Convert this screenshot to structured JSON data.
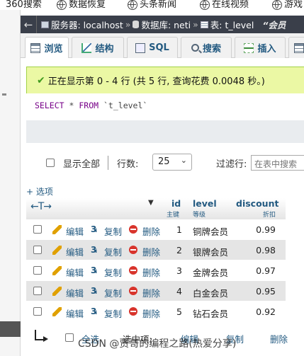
{
  "bookmarks": [
    "360搜索",
    "数据恢复",
    "头条新闻",
    "在线视频",
    "游戏"
  ],
  "breadcrumb": {
    "server": "服务器: localhost",
    "database": "数据库: neti",
    "table": "表: t_level",
    "right": "“会员"
  },
  "tabs": [
    {
      "label": "浏览",
      "icon": "browse-icon",
      "active": true
    },
    {
      "label": "结构",
      "icon": "structure-icon"
    },
    {
      "label": "SQL",
      "icon": "sql-icon"
    },
    {
      "label": "搜索",
      "icon": "search-icon"
    },
    {
      "label": "插入",
      "icon": "insert-icon"
    }
  ],
  "message": "正在显示第 0 - 4 行 (共 5 行, 查询花费 0.0048 秒。)",
  "sql": {
    "select": "SELECT",
    "star": "*",
    "from": "FROM",
    "table": "`t_level`"
  },
  "controls": {
    "show_all": "显示全部",
    "rows_label": "行数:",
    "rows_value": "25",
    "filter_label": "过滤行:",
    "filter_placeholder": "在表中搜索"
  },
  "options_link": "+ 选项",
  "table": {
    "columns": [
      {
        "name": "id",
        "sub": "主键"
      },
      {
        "name": "level",
        "sub": "等级"
      },
      {
        "name": "discount",
        "sub": "折扣"
      }
    ],
    "action_labels": {
      "edit": "编辑",
      "copy": "复制",
      "delete": "删除"
    },
    "rows": [
      {
        "id": "1",
        "level": "铜牌会员",
        "discount": "0.99"
      },
      {
        "id": "2",
        "level": "银牌会员",
        "discount": "0.98"
      },
      {
        "id": "3",
        "level": "金牌会员",
        "discount": "0.97"
      },
      {
        "id": "4",
        "level": "白金会员",
        "discount": "0.95"
      },
      {
        "id": "5",
        "level": "钻石会员",
        "discount": "0.92"
      }
    ]
  },
  "bottom": {
    "select_all": "全选",
    "selected_label": "选中项:",
    "edit": "编辑",
    "copy": "复制",
    "delete": "删除"
  },
  "watermark": "CSDN @贾哥的编程之路(热爱分享)"
}
